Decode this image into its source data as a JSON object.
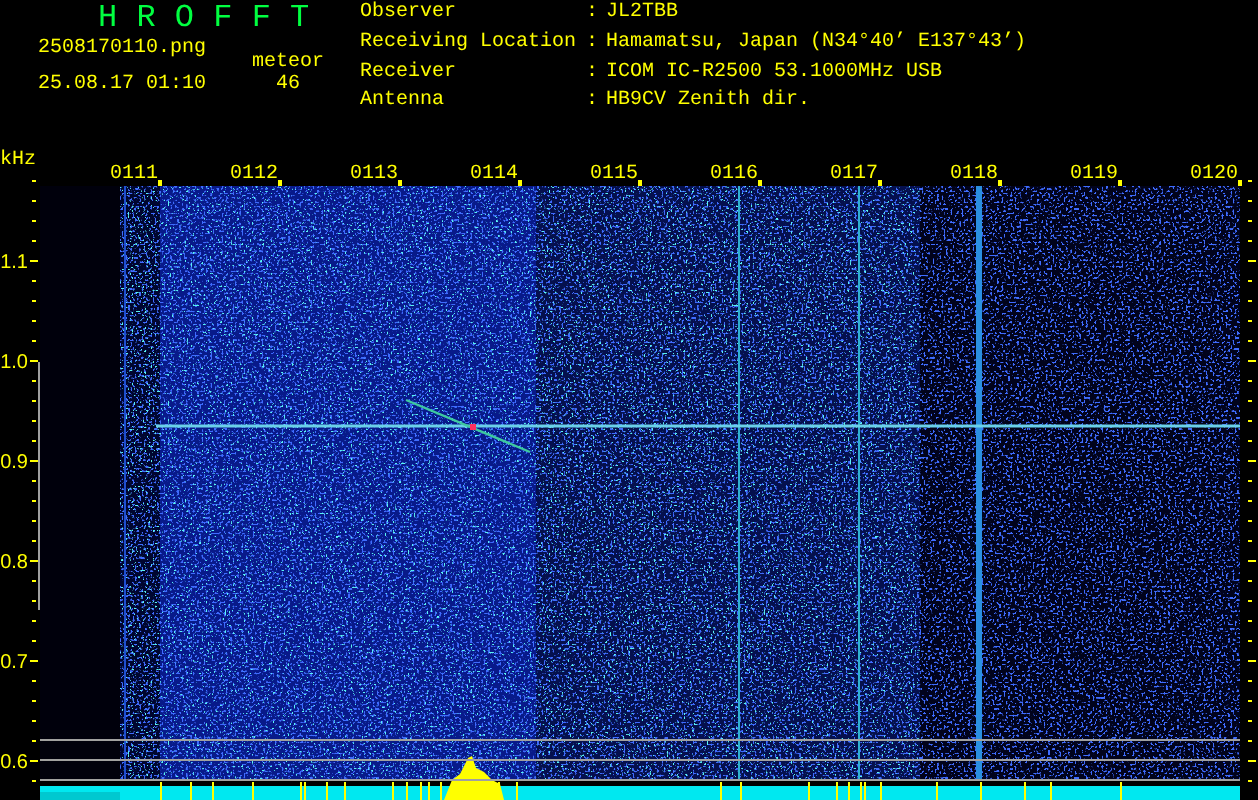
{
  "header": {
    "title": "H R O F F T",
    "file_name": "2508170110.png",
    "datetime": "25.08.17 01:10",
    "meteor_label": "meteor",
    "meteor_count": "46"
  },
  "station": [
    {
      "label": "Observer",
      "separator": ":",
      "value": "JL2TBB"
    },
    {
      "label": "Receiving Location",
      "separator": ":",
      "value": "Hamamatsu, Japan (N34°40’ E137°43’)"
    },
    {
      "label": "Receiver",
      "separator": ":",
      "value": "ICOM IC-R2500 53.1000MHz USB"
    },
    {
      "label": "Antenna",
      "separator": ":",
      "value": "HB9CV Zenith dir."
    }
  ],
  "spectrogram": {
    "unit": "kHz",
    "x_ticks": [
      "0111",
      "0112",
      "0113",
      "0114",
      "0115",
      "0116",
      "0117",
      "0118",
      "0119",
      "0120"
    ],
    "y_ticks": [
      "1.1",
      "1.0",
      "0.9",
      "0.8",
      "0.7",
      "0.6"
    ]
  }
}
